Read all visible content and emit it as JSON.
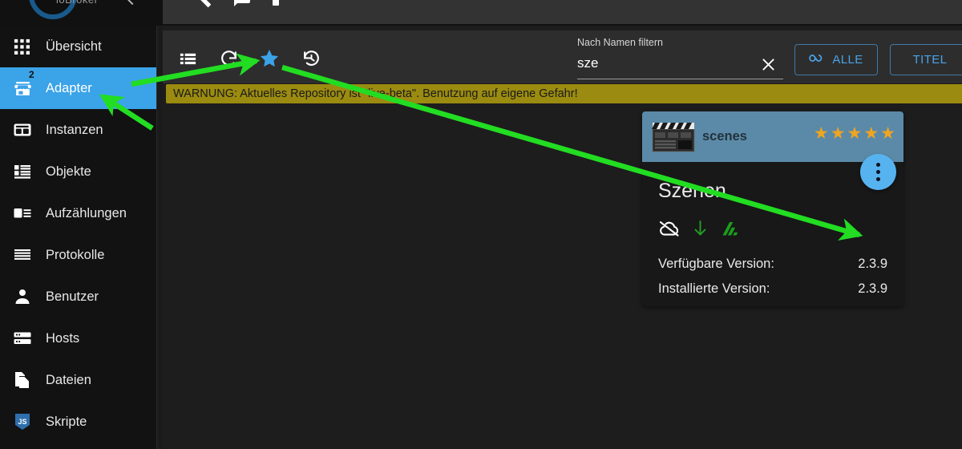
{
  "app": {
    "logo_text": "ioBroker",
    "accent": "#3ba3e8",
    "warning_color": "#9b8b10"
  },
  "header": {
    "icons": [
      "wrench-icon",
      "feedback-icon",
      "layout-icon"
    ]
  },
  "sidebar": {
    "items": [
      {
        "label": "Übersicht",
        "icon": "grid-icon",
        "badge": "",
        "active": false
      },
      {
        "label": "Adapter",
        "icon": "store-icon",
        "badge": "2",
        "active": true
      },
      {
        "label": "Instanzen",
        "icon": "instances-icon",
        "badge": "",
        "active": false
      },
      {
        "label": "Objekte",
        "icon": "objects-icon",
        "badge": "",
        "active": false
      },
      {
        "label": "Aufzählungen",
        "icon": "enums-icon",
        "badge": "",
        "active": false
      },
      {
        "label": "Protokolle",
        "icon": "logs-icon",
        "badge": "",
        "active": false
      },
      {
        "label": "Benutzer",
        "icon": "user-icon",
        "badge": "",
        "active": false
      },
      {
        "label": "Hosts",
        "icon": "hosts-icon",
        "badge": "",
        "active": false
      },
      {
        "label": "Dateien",
        "icon": "files-icon",
        "badge": "",
        "active": false
      },
      {
        "label": "Skripte",
        "icon": "javascript-icon",
        "badge": "",
        "active": false
      }
    ]
  },
  "toolbar": {
    "icons": [
      {
        "name": "list-view-icon",
        "active": false
      },
      {
        "name": "refresh-icon",
        "active": false
      },
      {
        "name": "star-icon",
        "active": true
      },
      {
        "name": "check-updates-icon",
        "active": false
      }
    ],
    "filter_label": "Nach Namen filtern",
    "filter_value": "sze",
    "filter_placeholder": "Nach Namen filtern",
    "clear_icon": "close-icon",
    "all_button": "ALLE",
    "all_button_icon": "infinity-icon",
    "title_button": "TITEL"
  },
  "warning": {
    "text": "WARNUNG: Aktuelles Repository ist \"live-beta\". Benutzung auf eigene Gefahr!"
  },
  "card": {
    "icon": "clapperboard-icon",
    "name": "scenes",
    "rating_stars": 5,
    "star_glyph": "★",
    "menu_icon": "more-vertical-icon",
    "title": "Szenen",
    "status_icons": [
      "cloud-off-icon",
      "download-arrow-icon",
      "statistics-icon"
    ],
    "available_version_label": "Verfügbare Version:",
    "available_version_value": "2.3.9",
    "installed_version_label": "Installierte Version:",
    "installed_version_value": "2.3.9"
  },
  "annotations": {
    "arrow_color": "#22dd22",
    "count": 3
  }
}
